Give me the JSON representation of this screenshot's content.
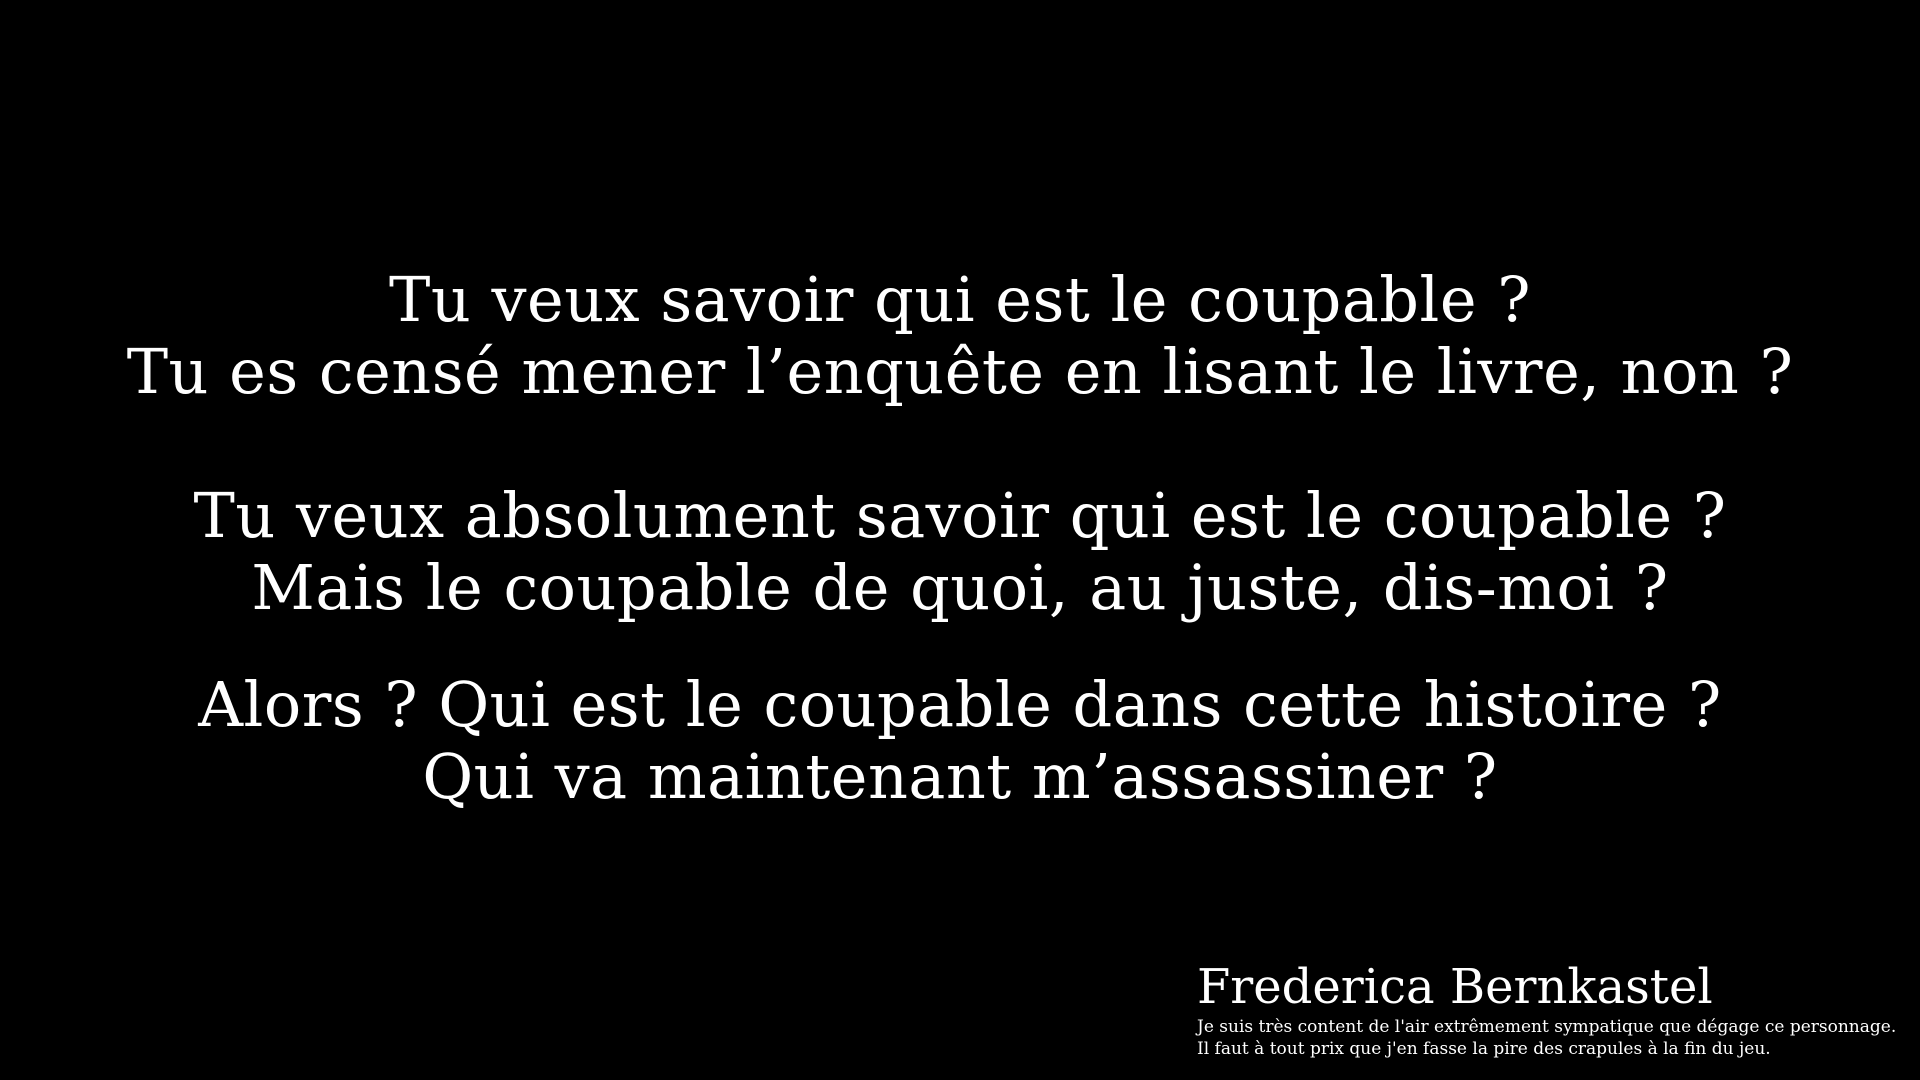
{
  "dialogue": {
    "block_1": {
      "line_1": "Tu veux savoir qui est le coupable ?",
      "line_2": "Tu es censé mener l’enquête en lisant le livre, non ?"
    },
    "block_2": {
      "line_1": "Tu veux absolument savoir qui est le coupable ?",
      "line_2": "Mais le coupable de quoi, au juste, dis-moi ?"
    },
    "block_3": {
      "line_1": "Alors ? Qui est le coupable dans cette histoire ?",
      "line_2": "Qui va maintenant m’assassiner ?"
    }
  },
  "character": {
    "name": "Frederica Bernkastel",
    "description_line_1": "Je suis très content de l'air extrêmement sympatique que dégage ce personnage.",
    "description_line_2": "Il faut à tout prix que j'en fasse la pire des crapules à la fin du jeu."
  },
  "colors": {
    "background": "#000000",
    "text": "#ffffff"
  }
}
